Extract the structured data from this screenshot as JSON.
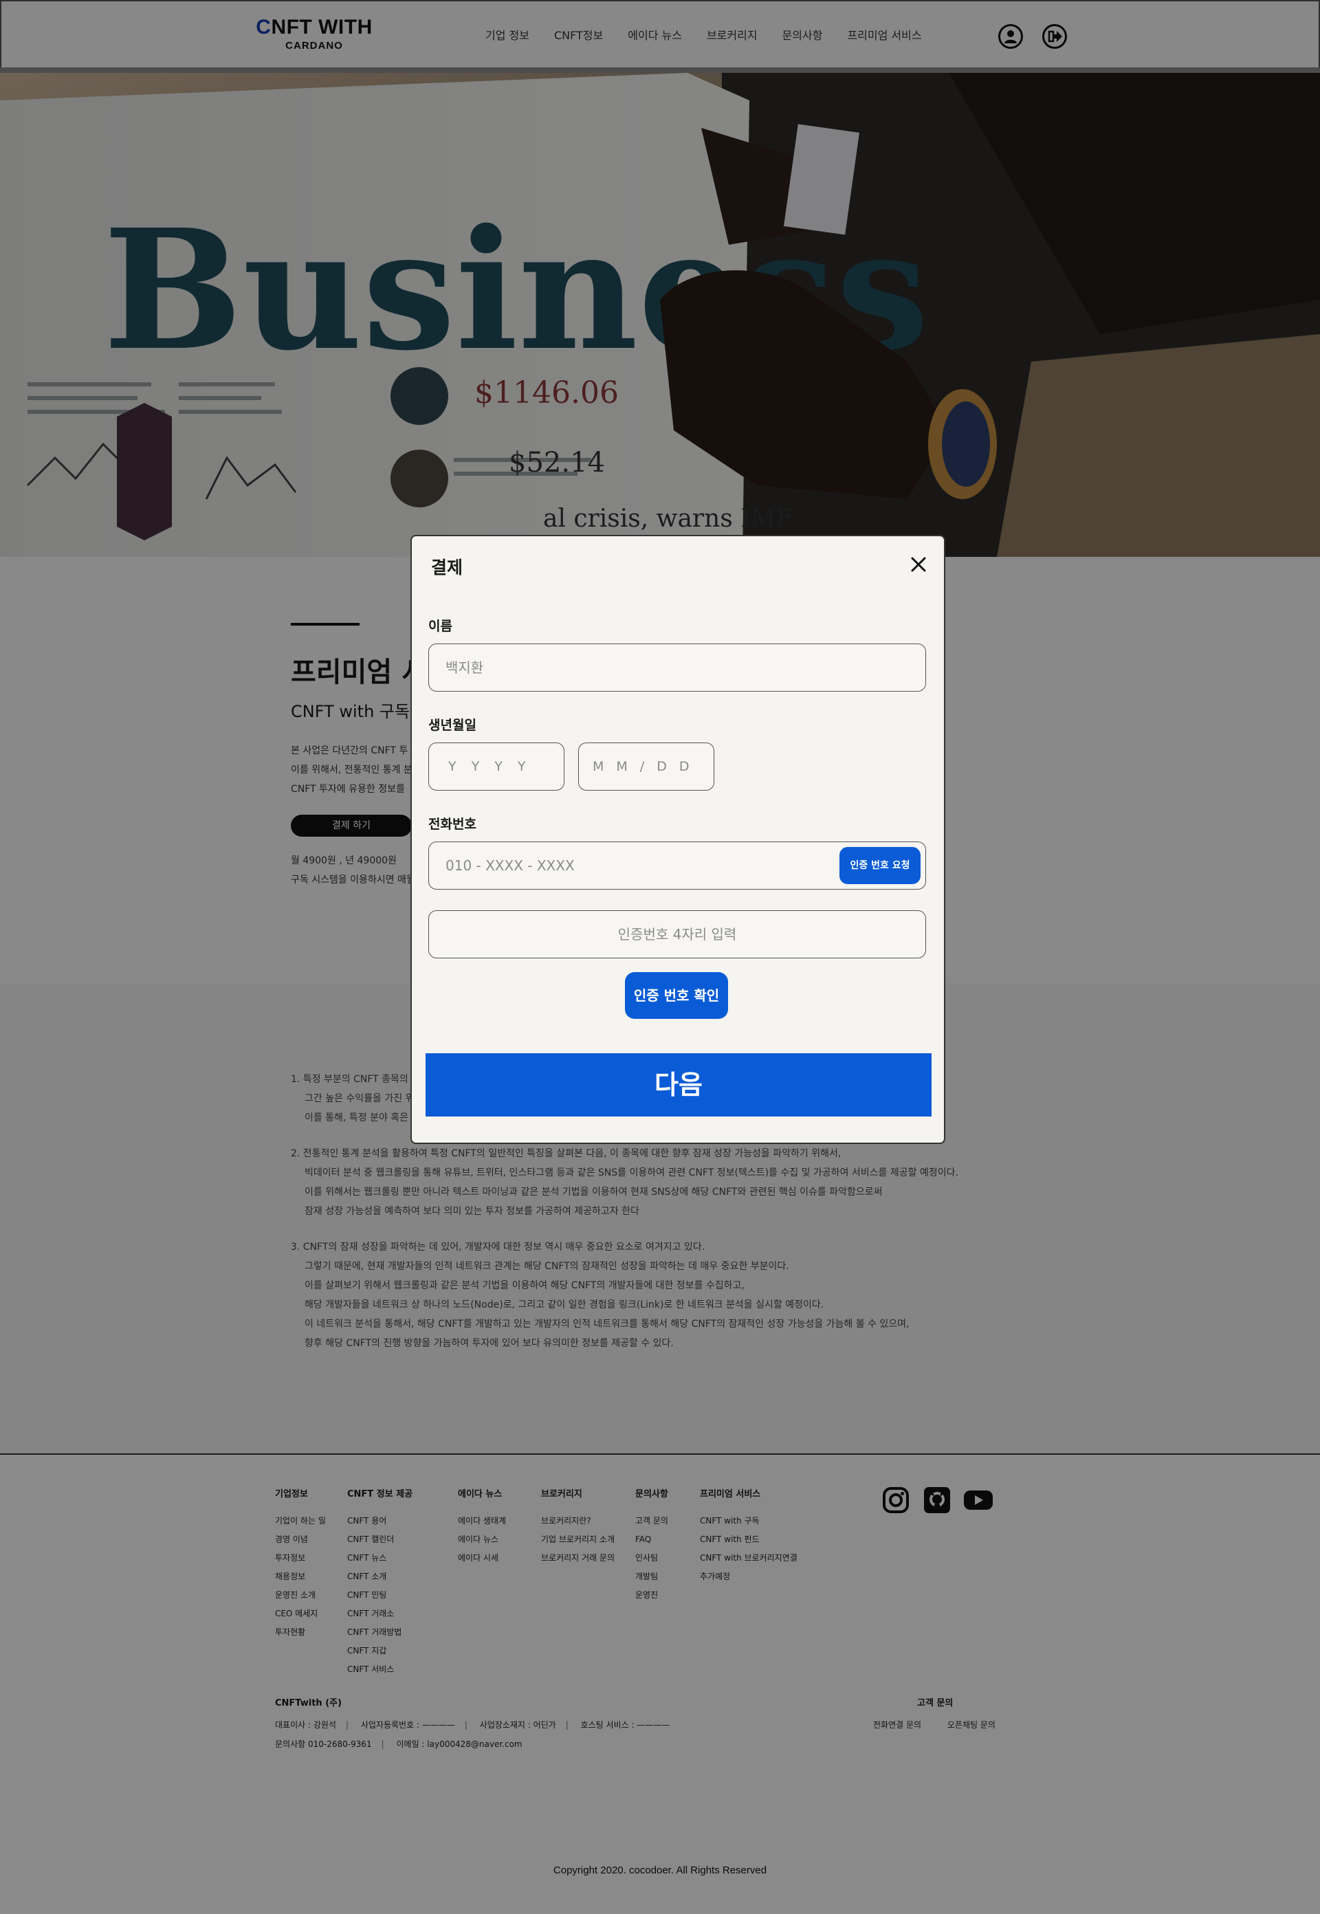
{
  "header": {
    "logo_main": "NFT WITH",
    "logo_first": "C",
    "logo_sub": "CARDANO",
    "nav": [
      "기업 정보",
      "CNFT정보",
      "에이다 뉴스",
      "브로커리지",
      "문의사항",
      "프리미엄 서비스"
    ],
    "profile_icon": "user-icon",
    "logout_icon": "logout-icon"
  },
  "hero": {
    "image_alt": "Business newspaper",
    "headline_text": "Business"
  },
  "premium": {
    "title": "프리미엄 서",
    "subtitle": "CNFT with 구독",
    "desc": [
      "본 사업은 다년간의 CNFT 투",
      "이를 위해서, 전통적인 통계 분",
      "CNFT 투자에 유용한 정보를"
    ],
    "pay_button": "결제 하기",
    "price": "월 4900원 , 년 49000원",
    "price_note": "구독 시스템을 이용하시면 매월"
  },
  "info": {
    "items": [
      [
        "1. 특정 부분의 CNFT 종목의",
        "그간 높은 수익률을 가진 위",
        "이를 통해, 특정 분야 혹은"
      ],
      [
        "2. 전통적인 통계 분석을 활용하여 특정 CNFT의 일반적인 특징을 살펴본 다음, 이 종목에 대한 향후 잠재 성장 가능성을 파악하기 위해서,",
        "빅데이터 분석 중 웹크롤링을 통해 유튜브, 트위터, 인스타그램 등과 같은 SNS를 이용하여 관련 CNFT 정보(텍스트)를 수집 및 가공하여 서비스를 제공할 예정이다.",
        "이를 위해서는 웹크롤링 뿐만 아니라 텍스트 마이닝과 같은 분석 기법을 이용하여 현재 SNS상에 해당 CNFT와 관련된 핵심 이슈를 파악함으로써",
        "잠재 성장 가능성을 예측하여 보다 의미 있는 투자 정보를 가공하여 제공하고자 한다"
      ],
      [
        "3. CNFT의 잠재 성장을 파악하는 데 있어, 개발자에 대한 정보 역시 매우 중요한 요소로 여겨지고 있다.",
        "그렇기 때문에, 현재 개발자들의 인적 네트워크 관계는 해당 CNFT의 잠재적인 성장을 파악하는 데 매우 중요한 부분이다.",
        "이를 살펴보기 위해서 웹크롤링과 같은 분석 기법을 이용하여 해당 CNFT의 개발자들에 대한 정보를 수집하고,",
        "해당 개발자들을 네트워크 상 하나의 노드(Node)로, 그리고 같이 일한 경험을 링크(Link)로 한 네트워크 분석을 실시할 예정이다.",
        "이 네트워크 분석을 통해서, 해당 CNFT를 개발하고 있는 개발자의 인적 네트워크를 통해서 해당 CNFT의 잠재적인 성장 가능성을 가늠해 볼 수 있으며,",
        "향후 해당 CNFT의 진행 방향을 가늠하여 투자에 있어 보다 유의미한 정보를 제공할 수 있다."
      ]
    ]
  },
  "footer": {
    "columns": [
      {
        "title": "기업정보",
        "items": [
          "기업이 하는 일",
          "경영 이념",
          "투자정보",
          "채용정보",
          "운영진 소개",
          "CEO 메세지",
          "투자현황"
        ]
      },
      {
        "title": "CNFT 정보 제공",
        "items": [
          "CNFT 용어",
          "CNFT 캘린더",
          "CNFT 뉴스",
          "CNFT 소개",
          "CNFT 민팅",
          "CNFT 거래소",
          "CNFT 거래방법",
          "CNFT 지갑",
          "CNFT 서비스"
        ]
      },
      {
        "title": "에이다 뉴스",
        "items": [
          "에이다 생태계",
          "에이다 뉴스",
          "에이다 시세"
        ]
      },
      {
        "title": "브로커리지",
        "items": [
          "브로커리지란?",
          "기업 브로커리지 소개",
          "브로커리지 거래 문의"
        ]
      },
      {
        "title": "문의사항",
        "items": [
          "고객 문의",
          "FAQ",
          "인사팀",
          "개발팀",
          "운영진"
        ]
      },
      {
        "title": "프리미엄 서비스",
        "items": [
          "CNFT with 구독",
          "CNFT with 펀드",
          "CNFT with 브로커리지연결",
          "추가예정"
        ]
      }
    ],
    "social": [
      "instagram-icon",
      "github-icon",
      "youtube-icon"
    ],
    "company": "CNFTwith (주)",
    "line1": [
      "대표이사 : 강원석",
      "사업자등록번호 : ————",
      "사업장소재지 : 어딘가",
      "호스팅 서비스 : ————"
    ],
    "line2": [
      "문의사항   010-2680-9361",
      "이메일 : lay000428@naver.com"
    ],
    "cs_title": "고객 문의",
    "cs_links": [
      "전화연결 문의",
      "오픈채팅 문의"
    ],
    "copyright": "Copyright 2020. cocodoer. All Rights Reserved"
  },
  "modal": {
    "title": "결제",
    "name_label": "이름",
    "name_placeholder": "백지환",
    "birth_label": "생년월일",
    "year_placeholder": "YYYY",
    "mmdd_placeholder": "MM/DD",
    "phone_label": "전화번호",
    "phone_placeholder": "010 - XXXX - XXXX",
    "request_button": "인증 번호 요청",
    "code_placeholder": "인증번호 4자리 입력",
    "verify_button": "인증 번호 확인",
    "next_button": "다음"
  },
  "colors": {
    "accent": "#0a5bd6",
    "logo_accent": "#1a3fb0",
    "overlay": "rgba(0,0,0,0.45)"
  }
}
